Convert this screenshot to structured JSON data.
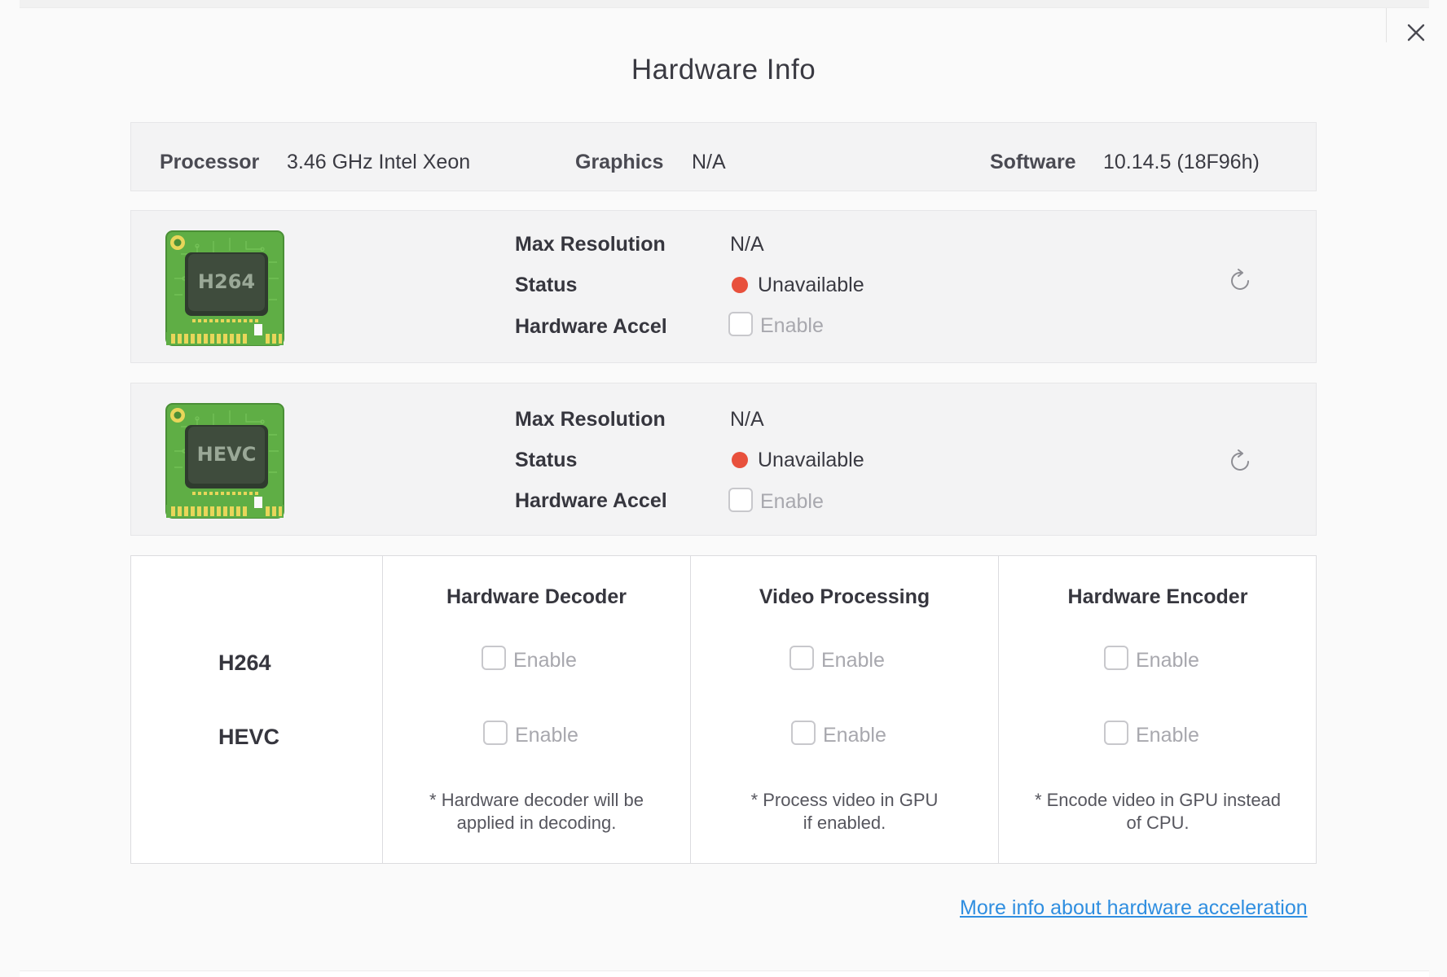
{
  "dialog": {
    "title": "Hardware Info",
    "close_icon": "close-icon"
  },
  "system": {
    "processor_label": "Processor",
    "processor_value": "3.46 GHz Intel Xeon",
    "graphics_label": "Graphics",
    "graphics_value": "N/A",
    "software_label": "Software",
    "software_value": "10.14.5 (18F96h)"
  },
  "codecs": [
    {
      "chip_text": "H264",
      "max_resolution_label": "Max Resolution",
      "max_resolution_value": "N/A",
      "status_label": "Status",
      "status_value": "Unavailable",
      "status_color": "#e8503c",
      "accel_label": "Hardware Accel",
      "accel_checkbox_label": "Enable",
      "accel_checked": false
    },
    {
      "chip_text": "HEVC",
      "max_resolution_label": "Max Resolution",
      "max_resolution_value": "N/A",
      "status_label": "Status",
      "status_value": "Unavailable",
      "status_color": "#e8503c",
      "accel_label": "Hardware Accel",
      "accel_checkbox_label": "Enable",
      "accel_checked": false
    }
  ],
  "matrix": {
    "columns": [
      "Hardware Decoder",
      "Video Processing",
      "Hardware Encoder"
    ],
    "rows": [
      "H264",
      "HEVC"
    ],
    "enable_label": "Enable",
    "notes": [
      [
        "* Hardware decoder will be",
        "applied in decoding."
      ],
      [
        "* Process video in GPU",
        "if enabled."
      ],
      [
        "* Encode video in GPU instead",
        "of CPU."
      ]
    ]
  },
  "footer": {
    "more_info_link": "More info about hardware acceleration"
  },
  "colors": {
    "chip_green": "#5fae45",
    "chip_dark": "#3c4a3a",
    "link": "#2f8ee0",
    "status_red": "#e8503c"
  }
}
